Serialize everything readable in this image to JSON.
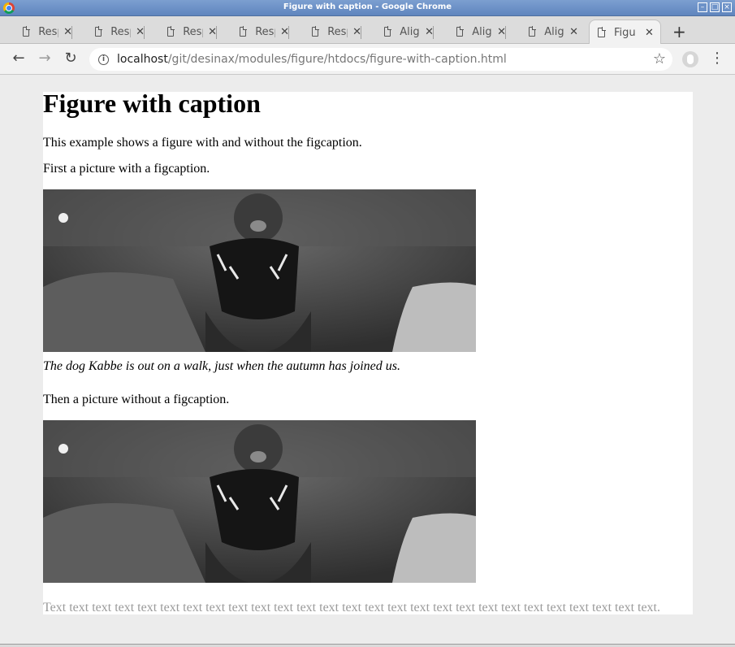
{
  "window": {
    "title": "Figure with caption - Google Chrome"
  },
  "tabs": [
    {
      "label": "Resp"
    },
    {
      "label": "Resp"
    },
    {
      "label": "Resp"
    },
    {
      "label": "Resp"
    },
    {
      "label": "Resp"
    },
    {
      "label": "Alig"
    },
    {
      "label": "Alig"
    },
    {
      "label": "Alig"
    },
    {
      "label": "Figu",
      "active": true
    }
  ],
  "toolbar": {
    "url_host": "localhost",
    "url_path": "/git/desinax/modules/figure/htdocs/figure-with-caption.html"
  },
  "page": {
    "heading": "Figure with caption",
    "intro": "This example shows a figure with and without the figcaption.",
    "first_label": "First a picture with a figcaption.",
    "caption": "The dog Kabbe is out on a walk, just when the autumn has joined us.",
    "second_label": "Then a picture without a figcaption.",
    "filler": "Text text text text text text text text text text text text text text text text text text text text text text text text text text text."
  },
  "icons": {
    "back": "arrow-left-icon",
    "forward": "arrow-right-icon",
    "reload": "reload-icon",
    "info": "info-icon",
    "star": "star-icon",
    "menu": "kebab-menu-icon",
    "tab": "document-icon"
  }
}
